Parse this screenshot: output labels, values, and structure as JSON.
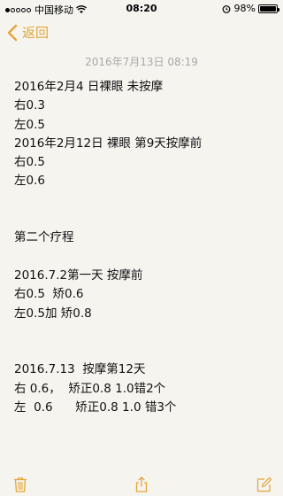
{
  "status_bar": {
    "carrier": "中国移动",
    "time": "08:20",
    "battery": "98%",
    "battery_level": 0.98
  },
  "nav": {
    "back_label": "返回"
  },
  "note": {
    "date": "2016年7月13日 08:19",
    "lines": [
      "2016年2月4 日裸眼 未按摩",
      "右0.3",
      "左0.5",
      "2016年2月12日 裸眼 第9天按摩前",
      "右0.5",
      "左0.6",
      "",
      "",
      "第二个疗程",
      "",
      "2016.7.2第一天 按摩前",
      "右0.5  矫0.6",
      "左0.5加 矫0.8",
      "",
      "",
      "2016.7.13  按摩第12天",
      "右 0.6，  矫正0.8 1.0错2个",
      "左  0.6      矫正0.8 1.0 错3个"
    ]
  },
  "colors": {
    "accent": "#e2a63c",
    "background": "#f5f4ef",
    "date_text": "#a9a9a9"
  },
  "icons": [
    "back-chevron-icon",
    "trash-icon",
    "share-icon",
    "compose-icon",
    "wifi-icon",
    "alarm-icon",
    "battery-icon"
  ]
}
